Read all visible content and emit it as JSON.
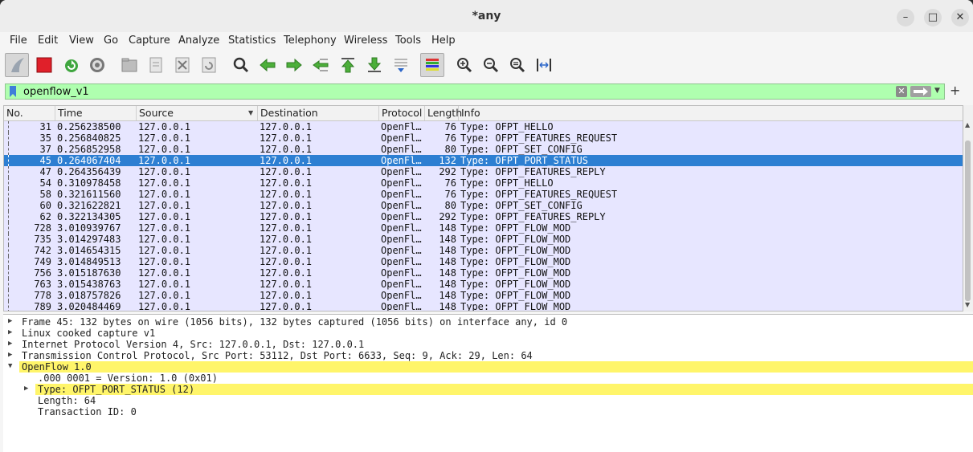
{
  "window": {
    "title": "*any"
  },
  "menu": [
    "File",
    "Edit",
    "View",
    "Go",
    "Capture",
    "Analyze",
    "Statistics",
    "Telephony",
    "Wireless",
    "Tools",
    "Help"
  ],
  "filter": {
    "value": "openflow_v1"
  },
  "columns": [
    "No.",
    "Time",
    "Source",
    "Destination",
    "Protocol",
    "Length",
    "Info"
  ],
  "packets": [
    {
      "no": "31",
      "time": "0.256238500",
      "src": "127.0.0.1",
      "dst": "127.0.0.1",
      "proto": "OpenFl…",
      "len": "76",
      "info": "Type: OFPT_HELLO"
    },
    {
      "no": "35",
      "time": "0.256840825",
      "src": "127.0.0.1",
      "dst": "127.0.0.1",
      "proto": "OpenFl…",
      "len": "76",
      "info": "Type: OFPT_FEATURES_REQUEST"
    },
    {
      "no": "37",
      "time": "0.256852958",
      "src": "127.0.0.1",
      "dst": "127.0.0.1",
      "proto": "OpenFl…",
      "len": "80",
      "info": "Type: OFPT_SET_CONFIG"
    },
    {
      "no": "45",
      "time": "0.264067404",
      "src": "127.0.0.1",
      "dst": "127.0.0.1",
      "proto": "OpenFl…",
      "len": "132",
      "info": "Type: OFPT_PORT_STATUS",
      "selected": true
    },
    {
      "no": "47",
      "time": "0.264356439",
      "src": "127.0.0.1",
      "dst": "127.0.0.1",
      "proto": "OpenFl…",
      "len": "292",
      "info": "Type: OFPT_FEATURES_REPLY"
    },
    {
      "no": "54",
      "time": "0.310978458",
      "src": "127.0.0.1",
      "dst": "127.0.0.1",
      "proto": "OpenFl…",
      "len": "76",
      "info": "Type: OFPT_HELLO"
    },
    {
      "no": "58",
      "time": "0.321611560",
      "src": "127.0.0.1",
      "dst": "127.0.0.1",
      "proto": "OpenFl…",
      "len": "76",
      "info": "Type: OFPT_FEATURES_REQUEST"
    },
    {
      "no": "60",
      "time": "0.321622821",
      "src": "127.0.0.1",
      "dst": "127.0.0.1",
      "proto": "OpenFl…",
      "len": "80",
      "info": "Type: OFPT_SET_CONFIG"
    },
    {
      "no": "62",
      "time": "0.322134305",
      "src": "127.0.0.1",
      "dst": "127.0.0.1",
      "proto": "OpenFl…",
      "len": "292",
      "info": "Type: OFPT_FEATURES_REPLY"
    },
    {
      "no": "728",
      "time": "3.010939767",
      "src": "127.0.0.1",
      "dst": "127.0.0.1",
      "proto": "OpenFl…",
      "len": "148",
      "info": "Type: OFPT_FLOW_MOD"
    },
    {
      "no": "735",
      "time": "3.014297483",
      "src": "127.0.0.1",
      "dst": "127.0.0.1",
      "proto": "OpenFl…",
      "len": "148",
      "info": "Type: OFPT_FLOW_MOD"
    },
    {
      "no": "742",
      "time": "3.014654315",
      "src": "127.0.0.1",
      "dst": "127.0.0.1",
      "proto": "OpenFl…",
      "len": "148",
      "info": "Type: OFPT_FLOW_MOD"
    },
    {
      "no": "749",
      "time": "3.014849513",
      "src": "127.0.0.1",
      "dst": "127.0.0.1",
      "proto": "OpenFl…",
      "len": "148",
      "info": "Type: OFPT_FLOW_MOD"
    },
    {
      "no": "756",
      "time": "3.015187630",
      "src": "127.0.0.1",
      "dst": "127.0.0.1",
      "proto": "OpenFl…",
      "len": "148",
      "info": "Type: OFPT_FLOW_MOD"
    },
    {
      "no": "763",
      "time": "3.015438763",
      "src": "127.0.0.1",
      "dst": "127.0.0.1",
      "proto": "OpenFl…",
      "len": "148",
      "info": "Type: OFPT_FLOW_MOD"
    },
    {
      "no": "778",
      "time": "3.018757826",
      "src": "127.0.0.1",
      "dst": "127.0.0.1",
      "proto": "OpenFl…",
      "len": "148",
      "info": "Type: OFPT_FLOW_MOD"
    },
    {
      "no": "789",
      "time": "3.020484469",
      "src": "127.0.0.1",
      "dst": "127.0.0.1",
      "proto": "OpenFl…",
      "len": "148",
      "info": "Type: OFPT_FLOW_MOD"
    }
  ],
  "details": [
    {
      "text": "Frame 45: 132 bytes on wire (1056 bits), 132 bytes captured (1056 bits) on interface any, id 0",
      "expander": "collapsed",
      "level": 0
    },
    {
      "text": "Linux cooked capture v1",
      "expander": "collapsed",
      "level": 0
    },
    {
      "text": "Internet Protocol Version 4, Src: 127.0.0.1, Dst: 127.0.0.1",
      "expander": "collapsed",
      "level": 0
    },
    {
      "text": "Transmission Control Protocol, Src Port: 53112, Dst Port: 6633, Seq: 9, Ack: 29, Len: 64",
      "expander": "collapsed",
      "level": 0
    },
    {
      "text": "OpenFlow 1.0",
      "expander": "expanded",
      "level": 0,
      "highlight": true
    },
    {
      "text": ".000 0001 = Version: 1.0 (0x01)",
      "expander": "none",
      "level": 1
    },
    {
      "text": "Type: OFPT_PORT_STATUS (12)",
      "expander": "collapsed",
      "level": 1,
      "highlight": true
    },
    {
      "text": "Length: 64",
      "expander": "none",
      "level": 1
    },
    {
      "text": "Transaction ID: 0",
      "expander": "none",
      "level": 1
    }
  ],
  "colors": {
    "selected_row": "#2d7fd2",
    "row_bg": "#e7e6ff",
    "filter_bg": "#afffaf",
    "highlight": "#fff56a"
  }
}
